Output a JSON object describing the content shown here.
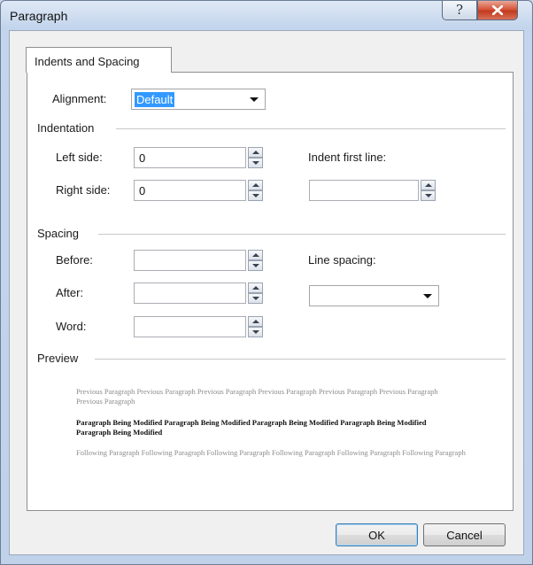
{
  "window": {
    "title": "Paragraph"
  },
  "tabs": [
    {
      "label": "Indents and Spacing",
      "active": true
    }
  ],
  "alignment": {
    "label": "Alignment:",
    "selected": "Default"
  },
  "indentation": {
    "heading": "Indentation",
    "left_label": "Left side:",
    "left_value": "0",
    "right_label": "Right side:",
    "right_value": "0",
    "first_line_label": "Indent first line:",
    "first_line_value": ""
  },
  "spacing": {
    "heading": "Spacing",
    "before_label": "Before:",
    "before_value": "",
    "after_label": "After:",
    "after_value": "",
    "word_label": "Word:",
    "word_value": "",
    "line_spacing_label": "Line spacing:",
    "line_spacing_value": ""
  },
  "preview": {
    "heading": "Preview",
    "previous_text": "Previous Paragraph Previous Paragraph Previous Paragraph Previous Paragraph Previous Paragraph Previous Paragraph Previous Paragraph",
    "modified_text": "Paragraph Being Modified Paragraph Being Modified Paragraph Being Modified Paragraph Being Modified Paragraph Being Modified",
    "following_text": "Following Paragraph Following Paragraph Following Paragraph Following Paragraph Following Paragraph Following Paragraph"
  },
  "buttons": {
    "ok": "OK",
    "cancel": "Cancel"
  },
  "icons": {
    "help": "question-mark-icon",
    "close": "close-x-icon"
  },
  "colors": {
    "selection": "#3399ff",
    "close_button": "#c94b2e",
    "title_bar": "#c9d7ea"
  }
}
